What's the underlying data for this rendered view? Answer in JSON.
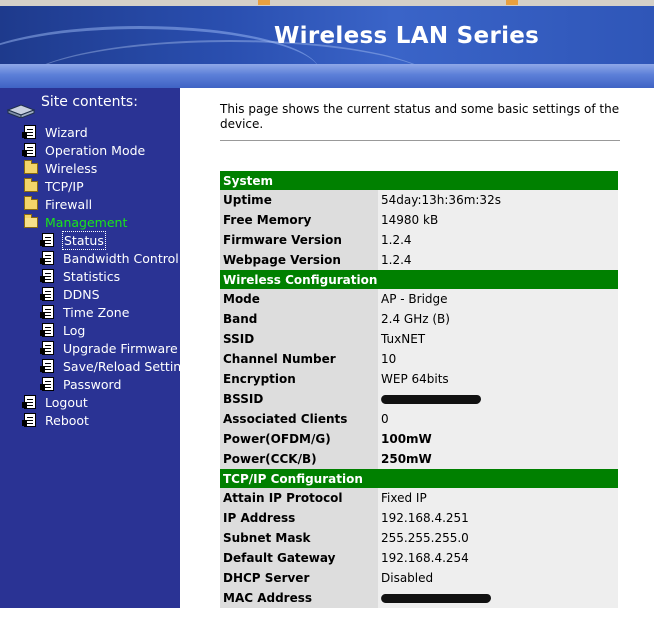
{
  "banner": {
    "title": "Wireless LAN Series"
  },
  "sidebar": {
    "heading": "Site contents:",
    "items": [
      {
        "label": "Wizard",
        "icon": "page-icon"
      },
      {
        "label": "Operation Mode",
        "icon": "page-icon"
      },
      {
        "label": "Wireless",
        "icon": "folder-icon"
      },
      {
        "label": "TCP/IP",
        "icon": "folder-icon"
      },
      {
        "label": "Firewall",
        "icon": "folder-icon"
      },
      {
        "label": "Management",
        "icon": "folder-open-icon"
      },
      {
        "label": "Status",
        "icon": "page-icon"
      },
      {
        "label": "Bandwidth Control",
        "icon": "page-icon"
      },
      {
        "label": "Statistics",
        "icon": "page-icon"
      },
      {
        "label": "DDNS",
        "icon": "page-icon"
      },
      {
        "label": "Time Zone",
        "icon": "page-icon"
      },
      {
        "label": "Log",
        "icon": "page-icon"
      },
      {
        "label": "Upgrade Firmware",
        "icon": "page-icon"
      },
      {
        "label": "Save/Reload Setting",
        "icon": "page-icon"
      },
      {
        "label": "Password",
        "icon": "page-icon"
      },
      {
        "label": "Logout",
        "icon": "page-icon"
      },
      {
        "label": "Reboot",
        "icon": "page-icon"
      }
    ]
  },
  "main": {
    "intro": "This page shows the current status and some basic settings of the device.",
    "sections": {
      "system": {
        "title": "System",
        "rows": [
          {
            "key": "Uptime",
            "value": "54day:13h:36m:32s"
          },
          {
            "key": "Free Memory",
            "value": "14980 kB"
          },
          {
            "key": "Firmware Version",
            "value": "1.2.4"
          },
          {
            "key": "Webpage Version",
            "value": "1.2.4"
          }
        ]
      },
      "wireless": {
        "title": "Wireless Configuration",
        "rows": [
          {
            "key": "Mode",
            "value": "AP - Bridge"
          },
          {
            "key": "Band",
            "value": "2.4 GHz (B)"
          },
          {
            "key": "SSID",
            "value": "TuxNET"
          },
          {
            "key": "Channel Number",
            "value": "10"
          },
          {
            "key": "Encryption",
            "value": "WEP 64bits"
          },
          {
            "key": "BSSID",
            "value": ""
          },
          {
            "key": "Associated Clients",
            "value": "0"
          },
          {
            "key": "Power(OFDM/G)",
            "value": "100mW"
          },
          {
            "key": "Power(CCK/B)",
            "value": "250mW"
          }
        ]
      },
      "tcpip": {
        "title": "TCP/IP Configuration",
        "rows": [
          {
            "key": "Attain IP Protocol",
            "value": "Fixed IP"
          },
          {
            "key": "IP Address",
            "value": "192.168.4.251"
          },
          {
            "key": "Subnet Mask",
            "value": "255.255.255.0"
          },
          {
            "key": "Default Gateway",
            "value": "192.168.4.254"
          },
          {
            "key": "DHCP Server",
            "value": "Disabled"
          },
          {
            "key": "MAC Address",
            "value": ""
          }
        ]
      }
    }
  },
  "colors": {
    "sidebar_bg": "#2a3394",
    "section_header": "#008000",
    "active_menu": "#19e619",
    "key_cell": "#dddddd",
    "value_cell": "#eeeeee"
  }
}
